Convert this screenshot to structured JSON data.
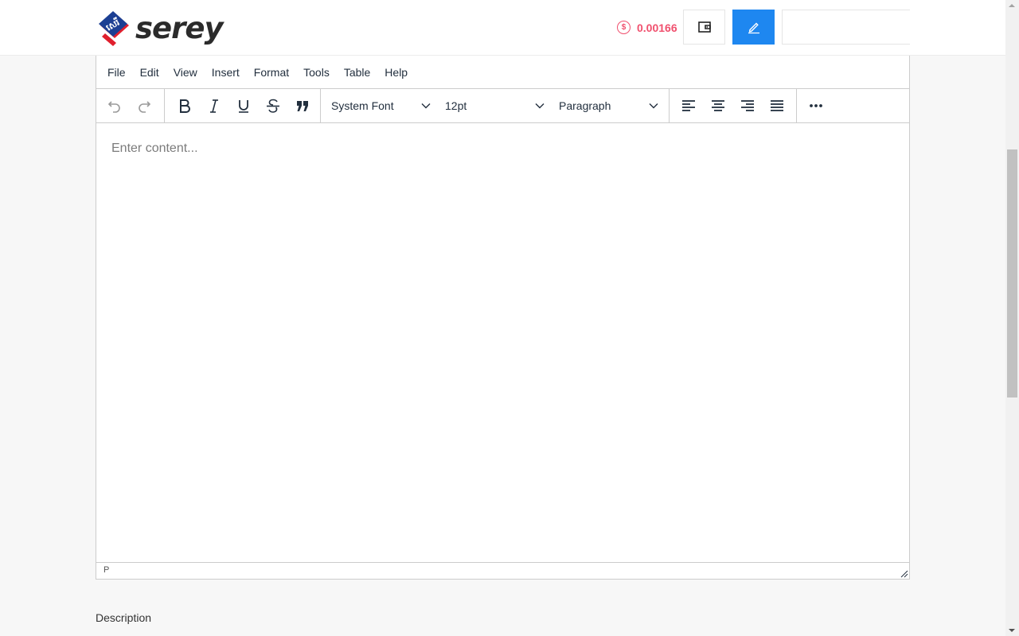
{
  "header": {
    "logo_text": "serey",
    "logo_mark_text": "សេរី",
    "balance_icon": "$",
    "balance": "0.00166",
    "wallet_icon": "wallet-icon",
    "write_icon": "pencil-icon"
  },
  "menubar": {
    "items": [
      "File",
      "Edit",
      "View",
      "Insert",
      "Format",
      "Tools",
      "Table",
      "Help"
    ]
  },
  "toolbar": {
    "font_family": "System Font",
    "font_size": "12pt",
    "block_format": "Paragraph"
  },
  "editor": {
    "placeholder": "Enter content...",
    "status_path": "P"
  },
  "form": {
    "description_label": "Description"
  },
  "colors": {
    "accent": "#1e87f0",
    "balance": "#f0506e",
    "icon": "#222f3e"
  }
}
